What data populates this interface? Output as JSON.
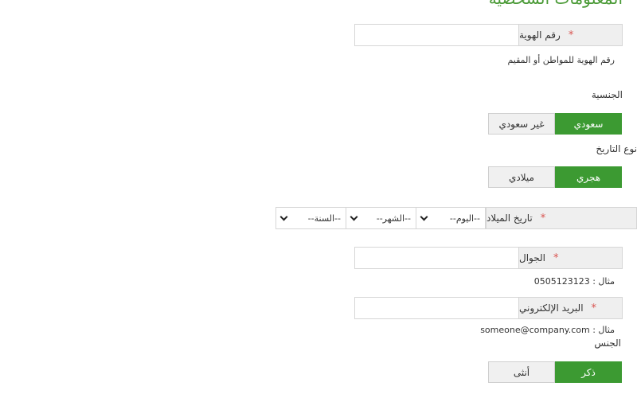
{
  "page": {
    "title": "المعلومات الشخصية"
  },
  "id_number": {
    "label": "رقم الهوية",
    "hint": "رقم الهوية للمواطن أو المقيم",
    "value": ""
  },
  "nationality": {
    "label": "الجنسية",
    "options": [
      "سعودي",
      "غير سعودي"
    ],
    "selected": "سعودي"
  },
  "date_type": {
    "label": "نوع التاريخ",
    "options": [
      "هجري",
      "ميلادي"
    ],
    "selected": "هجري"
  },
  "birth_date": {
    "label": "تاريخ الميلاد",
    "day": "--اليوم--",
    "month": "--الشهر--",
    "year": "--السنة--"
  },
  "mobile": {
    "label": "الجوال",
    "hint": "مثال : 0505123123",
    "value": ""
  },
  "email": {
    "label": "البريد الإلكتروني",
    "hint": "مثال : someone@company.com",
    "value": ""
  },
  "gender": {
    "label": "الجنس",
    "options": [
      "ذكر",
      "أنثى"
    ],
    "selected": "ذكر"
  },
  "colors": {
    "accent": "#3c9a32",
    "title": "#4a9a36",
    "required": "#d9534f",
    "label_bg": "#efefef"
  }
}
